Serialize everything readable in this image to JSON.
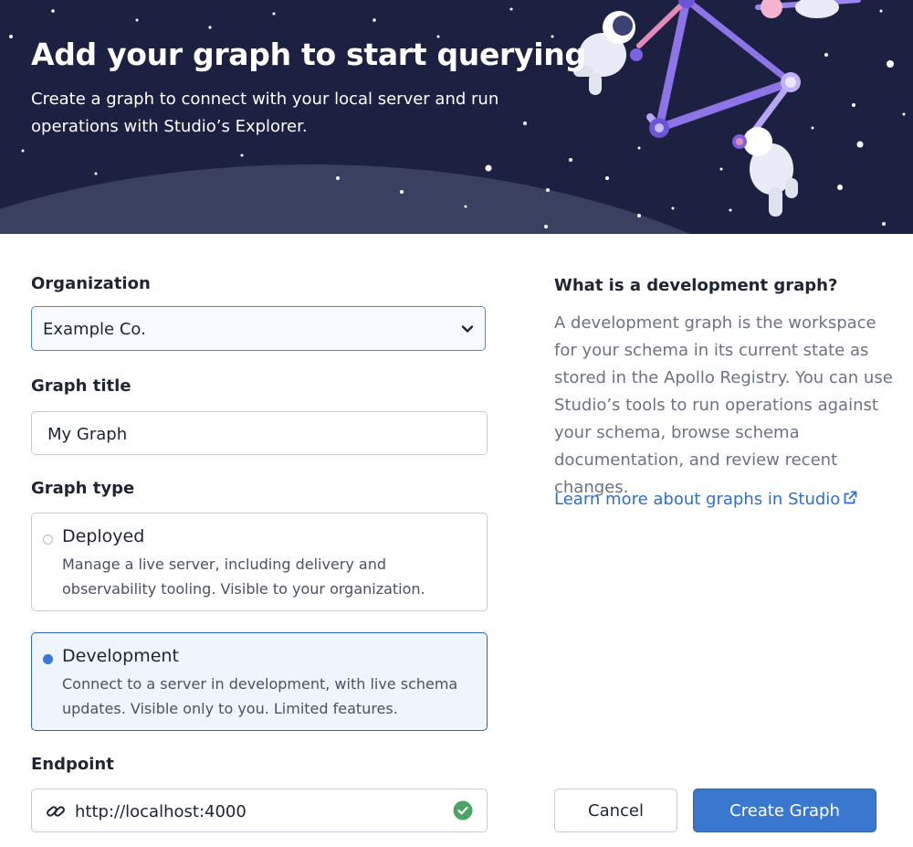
{
  "hero": {
    "title": "Add your graph to start querying",
    "subtitle": "Create a graph to connect with your local server and run operations with Studio’s Explorer.",
    "background_color": "#1c2141",
    "illustration": "astronauts-graph-illustration"
  },
  "form": {
    "organization": {
      "label": "Organization",
      "value": "Example Co."
    },
    "graph_title": {
      "label": "Graph title",
      "value": "My Graph"
    },
    "graph_type": {
      "label": "Graph type",
      "selected": "Development",
      "options": [
        {
          "title": "Deployed",
          "description": "Manage a live server, including delivery and observability tooling. Visible to your organization.",
          "selected": false
        },
        {
          "title": "Development",
          "description": "Connect to a server in development, with live schema updates. Visible only to you. Limited features.",
          "selected": true
        }
      ]
    },
    "endpoint": {
      "label": "Endpoint",
      "value": "http://localhost:4000",
      "icon": "link-icon",
      "status_icon": "check-circle-icon"
    }
  },
  "sidebar": {
    "title": "What is a development graph?",
    "body": "A development graph is the workspace for your schema in its current state as stored in the Apollo Registry. You can use Studio’s tools to run operations against your schema, browse schema documentation, and review recent changes.",
    "link": "Learn more about graphs in Studio"
  },
  "actions": {
    "cancel": "Cancel",
    "create": "Create Graph"
  },
  "colors": {
    "accent": "#3a78cf",
    "link": "#2f6fc9",
    "success": "#4aa564"
  }
}
